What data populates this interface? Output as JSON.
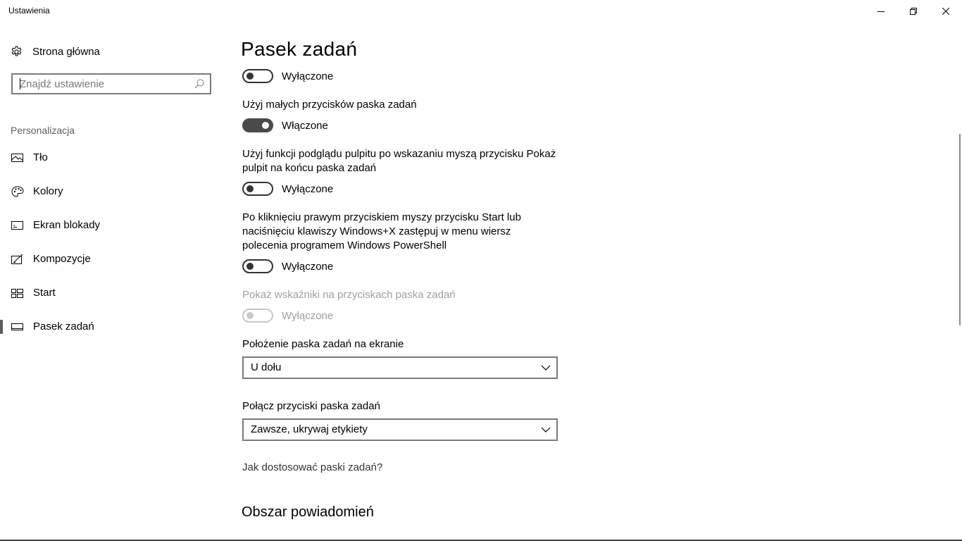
{
  "window": {
    "title": "Ustawienia",
    "minimize_icon": "minimize-icon",
    "restore_icon": "restore-icon",
    "close_icon": "close-icon"
  },
  "sidebar": {
    "home_label": "Strona główna",
    "search_placeholder": "Znajdź ustawienie",
    "section_label": "Personalizacja",
    "items": [
      {
        "label": "Tło",
        "icon": "picture-icon",
        "selected": false
      },
      {
        "label": "Kolory",
        "icon": "palette-icon",
        "selected": false
      },
      {
        "label": "Ekran blokady",
        "icon": "lock-screen-icon",
        "selected": false
      },
      {
        "label": "Kompozycje",
        "icon": "themes-icon",
        "selected": false
      },
      {
        "label": "Start",
        "icon": "start-icon",
        "selected": false
      },
      {
        "label": "Pasek zadań",
        "icon": "taskbar-icon",
        "selected": true
      }
    ]
  },
  "main": {
    "title": "Pasek zadań",
    "toggle_top": {
      "state": "Wyłączone",
      "on": false
    },
    "small_buttons": {
      "label": "Użyj małych przycisków paska zadań",
      "state": "Włączone",
      "on": true
    },
    "peek": {
      "label": "Użyj funkcji podglądu pulpitu po wskazaniu myszą przycisku Pokaż pulpit na końcu paska zadań",
      "state": "Wyłączone",
      "on": false
    },
    "powershell": {
      "label": "Po kliknięciu prawym przyciskiem myszy przycisku Start lub naciśnięciu klawiszy Windows+X zastępuj w menu wiersz polecenia programem Windows PowerShell",
      "state": "Wyłączone",
      "on": false
    },
    "badges": {
      "label": "Pokaż wskaźniki na przyciskach paska zadań",
      "state": "Wyłączone",
      "on": false,
      "disabled": true
    },
    "location": {
      "label": "Położenie paska zadań na ekranie",
      "value": "U dołu"
    },
    "combine": {
      "label": "Połącz przyciski paska zadań",
      "value": "Zawsze, ukrywaj etykiety"
    },
    "help_link": "Jak dostosować paski zadań?",
    "notification_heading": "Obszar powiadomień"
  },
  "colors": {
    "accent": "#4a4a4a",
    "disabled": "#a0a0a0",
    "border": "#7a7a7a"
  }
}
